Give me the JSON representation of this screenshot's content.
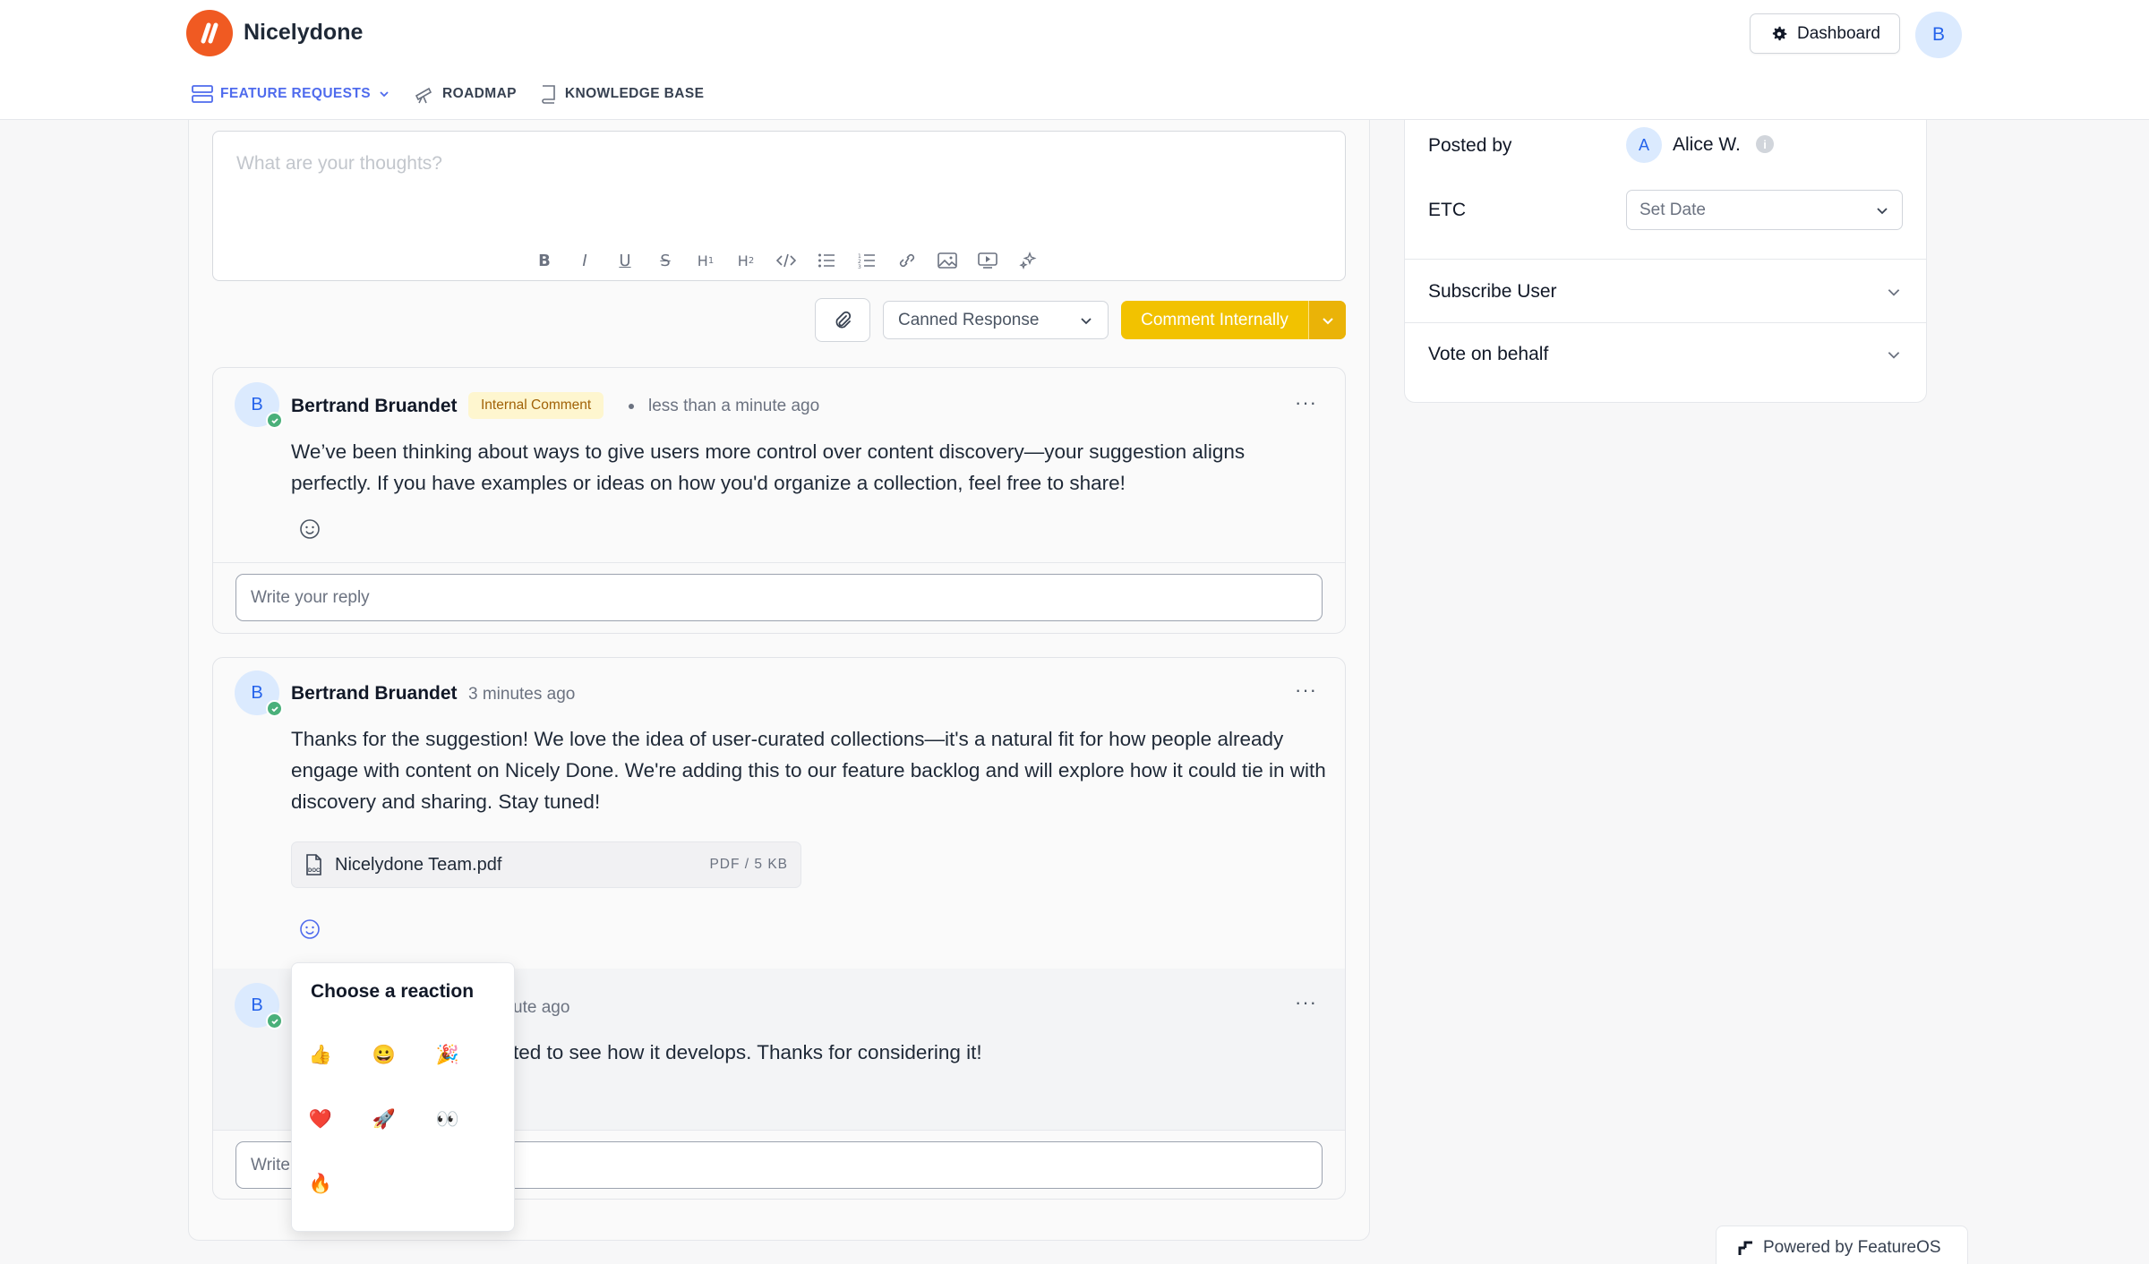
{
  "app": {
    "brand": "Nicelydone",
    "dashboard_label": "Dashboard",
    "user_initial": "B"
  },
  "nav": {
    "items": [
      {
        "label": "FEATURE REQUESTS",
        "icon": "list-icon",
        "active": true
      },
      {
        "label": "ROADMAP",
        "icon": "telescope-icon",
        "active": false
      },
      {
        "label": "KNOWLEDGE BASE",
        "icon": "book-icon",
        "active": false
      }
    ]
  },
  "editor": {
    "placeholder": "What are your thoughts?",
    "toolbar": [
      "bold-icon",
      "italic-icon",
      "underline-icon",
      "strikethrough-icon",
      "heading1-icon",
      "heading2-icon",
      "code-icon",
      "bullet-list-icon",
      "numbered-list-icon",
      "link-icon",
      "image-icon",
      "video-icon",
      "sparkle-icon"
    ]
  },
  "actions": {
    "canned_label": "Canned Response",
    "comment_label": "Comment Internally"
  },
  "comments": [
    {
      "initial": "B",
      "author": "Bertrand Bruandet",
      "badge": "Internal Comment",
      "time": "less than a minute ago",
      "body": "We’ve been thinking about ways to give users more control over content discovery—your suggestion aligns perfectly. If you have examples or ideas on how you'd organize a collection, feel free to share!",
      "reply_placeholder": "Write your reply"
    },
    {
      "initial": "B",
      "author": "Bertrand Bruandet",
      "time": "3 minutes ago",
      "body": "Thanks for the suggestion! We love the idea of user-curated collections—it's a natural fit for how people already engage with content on Nicely Done. We're adding this to our feature backlog and will explore how it could tie in with discovery and sharing. Stay tuned!",
      "attachment": {
        "name": "Nicelydone Team.pdf",
        "meta": "PDF / 5 KB"
      },
      "reply": {
        "initial": "B",
        "time_partial": "ute ago",
        "body_partial": "ted to see how it develops. Thanks for considering it!"
      },
      "reply_placeholder_partial": "Write"
    }
  ],
  "reaction_popup": {
    "title": "Choose a reaction",
    "emojis": [
      "👍",
      "😀",
      "🎉",
      "❤️",
      "🚀",
      "👀",
      "🔥"
    ]
  },
  "sidebar": {
    "posted_by_label": "Posted by",
    "posted_by_initial": "A",
    "posted_by_name": "Alice W.",
    "etc_label": "ETC",
    "etc_value": "Set Date",
    "subscribe_label": "Subscribe User",
    "vote_label": "Vote on behalf"
  },
  "footer": {
    "powered_by": "Powered by FeatureOS"
  },
  "colors": {
    "brand": "#f05a22",
    "accent": "#4f6bed",
    "comment_button": "#f2c200",
    "verified": "#4ab07a"
  }
}
